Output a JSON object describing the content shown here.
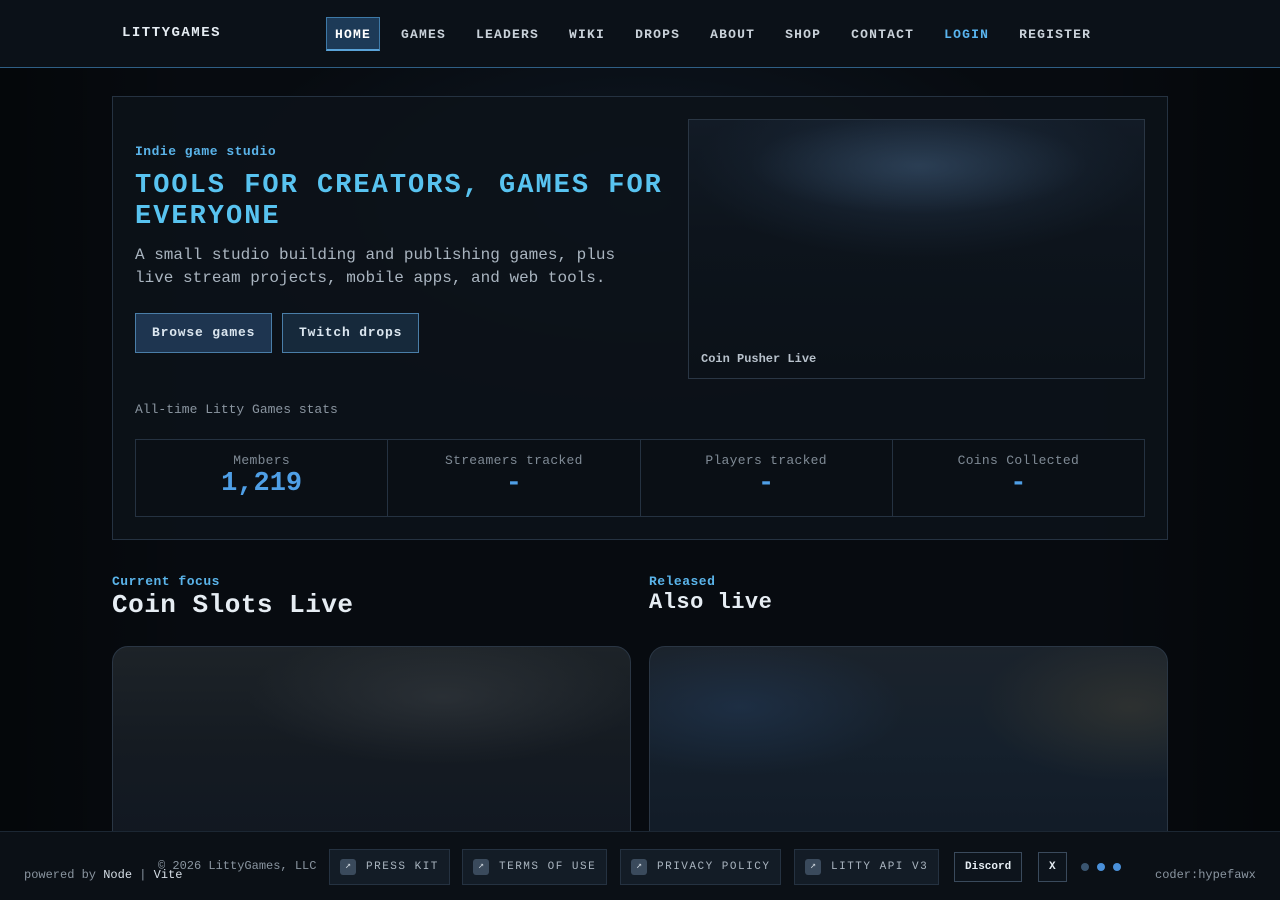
{
  "nav": {
    "brand": "LITTYGAMES",
    "items": [
      {
        "label": "HOME",
        "active": true
      },
      {
        "label": "GAMES"
      },
      {
        "label": "LEADERS"
      },
      {
        "label": "WIKI"
      },
      {
        "label": "DROPS"
      },
      {
        "label": "ABOUT"
      },
      {
        "label": "SHOP"
      },
      {
        "label": "CONTACT"
      },
      {
        "label": "LOGIN",
        "accent": true
      },
      {
        "label": "REGISTER"
      }
    ]
  },
  "hero": {
    "eyebrow": "Indie game studio",
    "title": "TOOLS FOR CREATORS, GAMES FOR EVERYONE",
    "description": "A small studio building and publishing games, plus live stream projects, mobile apps, and web tools.",
    "buttons": {
      "browse": "Browse games",
      "drops": "Twitch drops"
    },
    "media_caption": "Coin Pusher Live",
    "stats_label": "All-time Litty Games stats",
    "stats": [
      {
        "label": "Members",
        "value": "1,219"
      },
      {
        "label": "Streamers tracked",
        "value": "-"
      },
      {
        "label": "Players tracked",
        "value": "-"
      },
      {
        "label": "Coins Collected",
        "value": "-"
      }
    ]
  },
  "sections": {
    "focus": {
      "eyebrow": "Current focus",
      "title": "Coin Slots Live"
    },
    "released": {
      "eyebrow": "Released",
      "title": "Also live"
    }
  },
  "footer": {
    "powered_prefix": "powered by",
    "powered_node": "Node",
    "powered_sep": "|",
    "powered_vite": "Vite",
    "copyright": "© 2026 LittyGames, LLC",
    "links": [
      "PRESS KIT",
      "TERMS OF USE",
      "PRIVACY POLICY",
      "LITTY API V3"
    ],
    "social": {
      "discord": "Discord",
      "x": "X"
    },
    "coder": "coder:hypefawx"
  },
  "colors": {
    "accent": "#58c3f0",
    "stat_value": "#4f9fe6",
    "background": "#070b10"
  }
}
